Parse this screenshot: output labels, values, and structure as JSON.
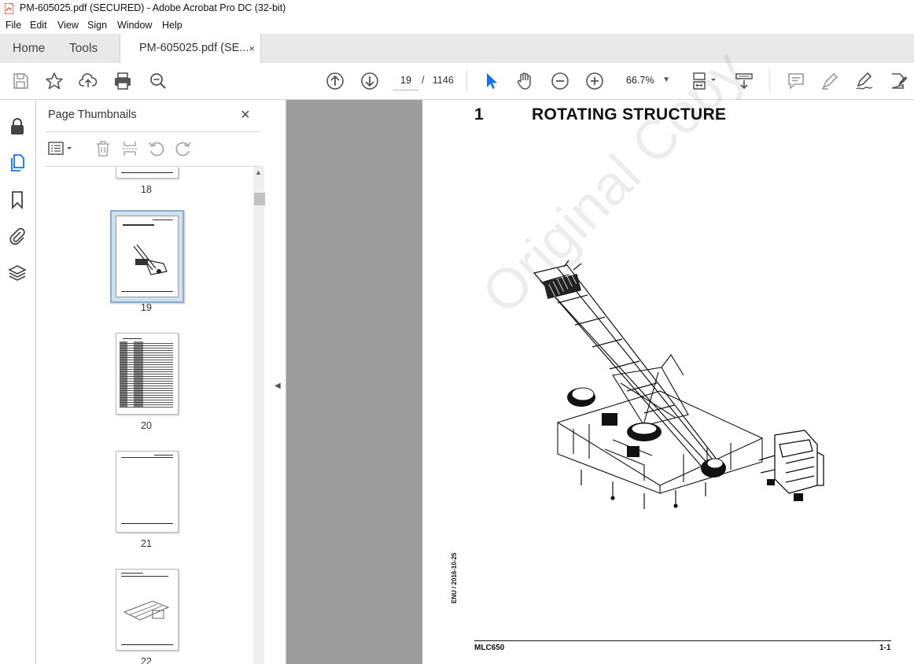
{
  "window": {
    "title": "PM-605025.pdf (SECURED) - Adobe Acrobat Pro DC (32-bit)"
  },
  "menu": [
    "File",
    "Edit",
    "View",
    "Sign",
    "Window",
    "Help"
  ],
  "tabs": {
    "home": "Home",
    "tools": "Tools",
    "doc": "PM-605025.pdf (SE...",
    "close": "×"
  },
  "nav": {
    "current_page": "19",
    "separator": "/",
    "total_pages": "1146",
    "zoom": "66.7%"
  },
  "panel": {
    "title": "Page Thumbnails",
    "close": "×",
    "thumbnails": [
      {
        "label": "18",
        "selected": false
      },
      {
        "label": "19",
        "selected": true
      },
      {
        "label": "20",
        "selected": false
      },
      {
        "label": "21",
        "selected": false
      },
      {
        "label": "22",
        "selected": false
      }
    ]
  },
  "page": {
    "chapter_number": "1",
    "chapter_title": "ROTATING STRUCTURE",
    "watermark": "Original Copy",
    "side_code": "ENU / 2016-10-25",
    "footer_left": "MLC650",
    "footer_right": "1-1"
  },
  "icons": {
    "toolbar": [
      "save-icon",
      "star-icon",
      "upload-icon",
      "print-icon",
      "zoom-search-icon",
      "page-up-icon",
      "page-down-icon",
      "select-cursor-icon",
      "hand-icon",
      "zoom-out-icon",
      "zoom-in-icon",
      "page-fit-icon",
      "scroll-mode-icon",
      "comment-icon",
      "highlight-icon",
      "sign-icon",
      "edit-pdf-icon"
    ],
    "rail": [
      "lock-icon",
      "pages-icon",
      "bookmark-icon",
      "attachment-icon",
      "layers-icon"
    ]
  },
  "colors": {
    "accent": "#1473e6",
    "selection": "#cfe0ee",
    "viewer_bg": "#9d9d9d",
    "pdf_icon": "#d4392b"
  }
}
